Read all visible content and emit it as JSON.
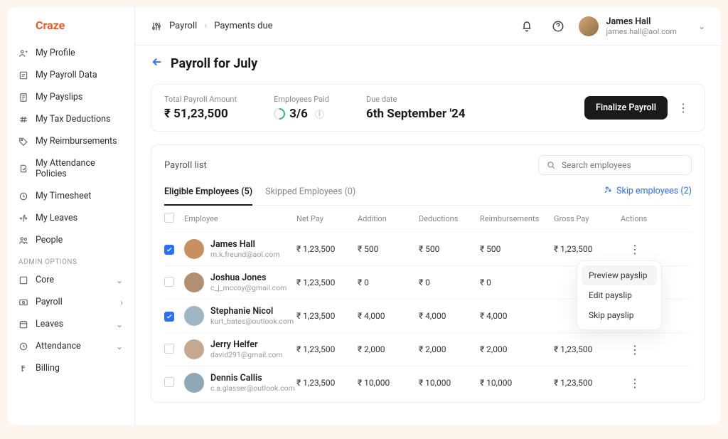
{
  "brand": {
    "name": "Craze"
  },
  "nav": {
    "items": [
      {
        "label": "My Profile"
      },
      {
        "label": "My Payroll Data"
      },
      {
        "label": "My Payslips"
      },
      {
        "label": "My Tax Deductions"
      },
      {
        "label": "My Reimbursements"
      },
      {
        "label": "My Attendance Policies"
      },
      {
        "label": "My Timesheet"
      },
      {
        "label": "My Leaves"
      },
      {
        "label": "People"
      }
    ],
    "admin_label": "ADMIN OPTIONS",
    "admin_items": [
      {
        "label": "Core"
      },
      {
        "label": "Payroll"
      },
      {
        "label": "Leaves"
      },
      {
        "label": "Attendance"
      },
      {
        "label": "Billing"
      }
    ]
  },
  "breadcrumb": {
    "a": "Payroll",
    "b": "Payments due"
  },
  "user": {
    "name": "James Hall",
    "email": "james.hall@aol.com"
  },
  "page": {
    "title": "Payroll for July"
  },
  "summary": {
    "total_label": "Total Payroll Amount",
    "total_value": "₹ 51,23,500",
    "paid_label": "Employees Paid",
    "paid_value": "3/6",
    "due_label": "Due date",
    "due_value": "6th September '24",
    "finalize_btn": "Finalize Payroll"
  },
  "list": {
    "title": "Payroll list",
    "search_placeholder": "Search employees",
    "tab_eligible": "Eligible Employees (5)",
    "tab_skipped": "Skipped Employees (0)",
    "skip_link": "Skip employees (2)",
    "cols": {
      "employee": "Employee",
      "netpay": "Net Pay",
      "addition": "Addition",
      "deductions": "Deductions",
      "reimbursements": "Reimbursements",
      "grosspay": "Gross Pay",
      "actions": "Actions"
    },
    "rows": [
      {
        "checked": true,
        "name": "James Hall",
        "email": "m.k.freund@aol.com",
        "net": "₹ 1,23,500",
        "add": "₹ 500",
        "ded": "₹ 500",
        "reimb": "₹ 500",
        "gross": "₹ 1,23,500"
      },
      {
        "checked": false,
        "name": "Joshua Jones",
        "email": "c_j_mccoy@gmail.com",
        "net": "₹ 1,23,500",
        "add": "₹ 0",
        "ded": "₹ 0",
        "reimb": "₹ 0",
        "gross": ""
      },
      {
        "checked": true,
        "name": "Stephanie Nicol",
        "email": "kurt_bates@outlook.com",
        "net": "₹ 1,23,500",
        "add": "₹ 4,000",
        "ded": "₹ 4,000",
        "reimb": "₹ 4,000",
        "gross": ""
      },
      {
        "checked": false,
        "name": "Jerry Helfer",
        "email": "david291@gmail.com",
        "net": "₹ 1,23,500",
        "add": "₹ 2,000",
        "ded": "₹ 2,000",
        "reimb": "₹ 2,000",
        "gross": "₹ 1,23,500"
      },
      {
        "checked": false,
        "name": "Dennis Callis",
        "email": "c.a.glasser@outlook.com",
        "net": "₹ 1,23,500",
        "add": "₹ 10,000",
        "ded": "₹ 10,000",
        "reimb": "₹ 10,000",
        "gross": "₹ 1,23,500"
      }
    ]
  },
  "popup": {
    "preview": "Preview payslip",
    "edit": "Edit payslip",
    "skip": "Skip payslip"
  }
}
